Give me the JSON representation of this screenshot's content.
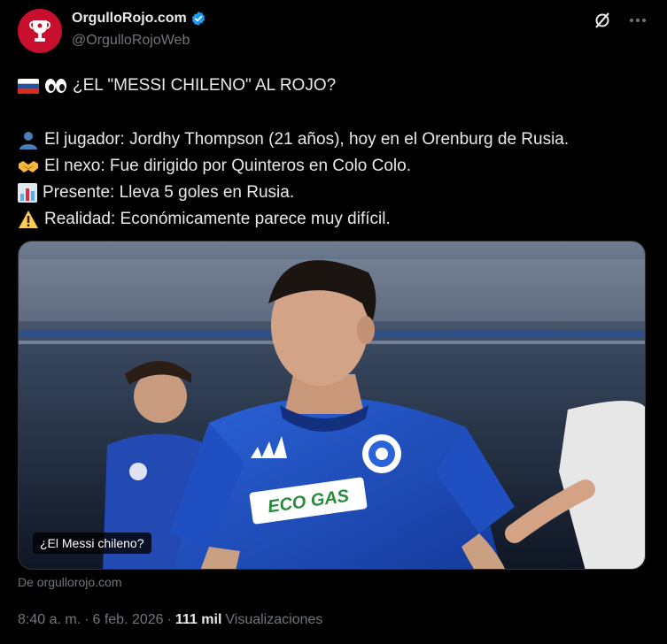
{
  "author": {
    "display_name": "OrgulloRojo.com",
    "handle": "@OrgulloRojoWeb",
    "avatar_icon": "trophy-logo-icon",
    "avatar_color": "#c8102e",
    "verified_color": "#1d9bf0"
  },
  "top_actions": {
    "grok_icon": "grok-icon",
    "more_icon": "more-icon"
  },
  "tweet": {
    "headline": "¿EL \"MESSI CHILENO\" AL ROJO?",
    "lines": [
      {
        "icon": "person-icon",
        "text": "El jugador: Jordhy Thompson (21 años), hoy en el Orenburg de Rusia."
      },
      {
        "icon": "handshake-icon",
        "text": "El nexo: Fue dirigido por Quinteros en Colo Colo."
      },
      {
        "icon": "bar-chart-icon",
        "text": "Presente: Lleva 5 goles en Rusia."
      },
      {
        "icon": "warning-icon",
        "text": "Realidad: Económicamente parece muy difícil."
      }
    ]
  },
  "media": {
    "alt_badge": "¿El Messi chileno?",
    "source": "De orgullorojo.com",
    "jersey_sponsor": "ECO GAS"
  },
  "meta": {
    "time": "8:40 a. m.",
    "dot1": "·",
    "date": "6 feb. 2026",
    "dot2": "·",
    "views_count": "111 mil",
    "views_label": "Visualizaciones"
  }
}
